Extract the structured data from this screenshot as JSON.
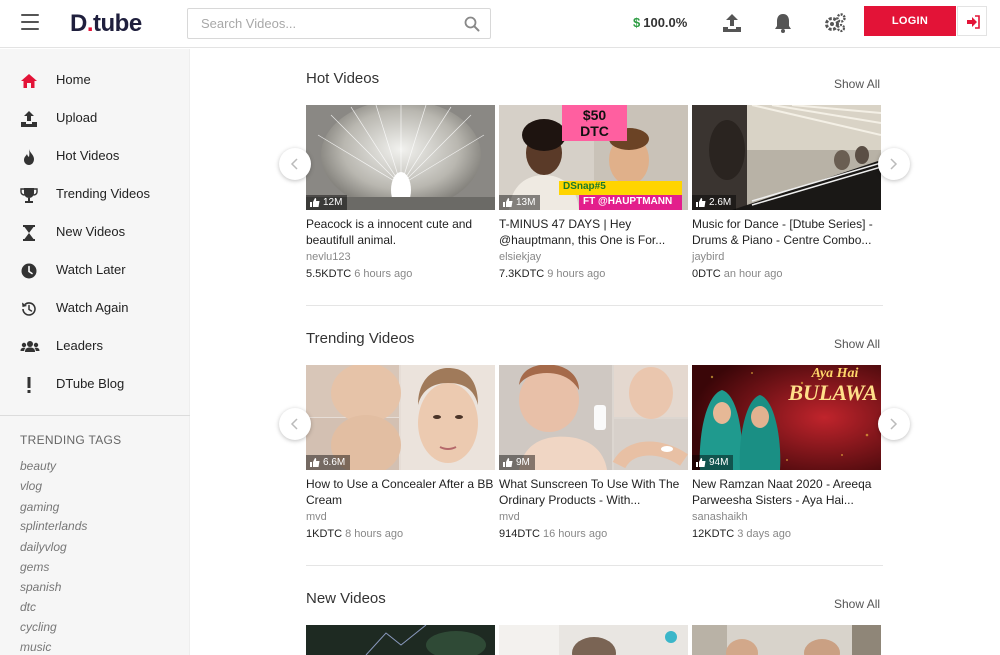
{
  "header": {
    "logo_main": "D",
    "logo_dot": ".",
    "logo_tail": "tube",
    "search_placeholder": "Search Videos...",
    "balance_currency": "$",
    "balance": "100.0%",
    "login_label": "LOGIN"
  },
  "colors": {
    "brand": "#e31337",
    "money": "#2e9d44"
  },
  "sidebar": {
    "items": [
      {
        "label": "Home",
        "icon": "home-icon"
      },
      {
        "label": "Upload",
        "icon": "upload-icon"
      },
      {
        "label": "Hot Videos",
        "icon": "flame-icon"
      },
      {
        "label": "Trending Videos",
        "icon": "trophy-icon"
      },
      {
        "label": "New Videos",
        "icon": "hourglass-icon"
      },
      {
        "label": "Watch Later",
        "icon": "clock-icon"
      },
      {
        "label": "Watch Again",
        "icon": "history-icon"
      },
      {
        "label": "Leaders",
        "icon": "users-icon"
      },
      {
        "label": "DTube Blog",
        "icon": "exclamation-icon"
      }
    ],
    "tags_title": "TRENDING TAGS",
    "tags": [
      "beauty",
      "vlog",
      "gaming",
      "splinterlands",
      "dailyvlog",
      "gems",
      "spanish",
      "dtc",
      "cycling",
      "music"
    ]
  },
  "sections": [
    {
      "title": "Hot Videos",
      "show_all": "Show All",
      "videos": [
        {
          "views": "12M",
          "title": "Peacock is a innocent cute and beautifull animal.",
          "author": "nevlu123",
          "value": "5.5KDTC",
          "ago": "6 hours ago"
        },
        {
          "views": "13M",
          "title": "T-MINUS 47 DAYS | Hey @hauptmann, this One is For...",
          "author": "elsiekjay",
          "value": "7.3KDTC",
          "ago": "9 hours ago",
          "thumb_text": [
            "$50",
            "DTC",
            "DSnap#5",
            "FT @HAUPTMANN"
          ]
        },
        {
          "views": "2.6M",
          "title": "Music for Dance - [Dtube Series] - Drums & Piano - Centre Combo...",
          "author": "jaybird",
          "value": "0DTC",
          "ago": "an hour ago"
        }
      ]
    },
    {
      "title": "Trending Videos",
      "show_all": "Show All",
      "videos": [
        {
          "views": "6.6M",
          "title": "How to Use a Concealer After a BB Cream",
          "author": "mvd",
          "value": "1KDTC",
          "ago": "8 hours ago"
        },
        {
          "views": "9M",
          "title": "What Sunscreen To Use With The Ordinary Products - With...",
          "author": "mvd",
          "value": "914DTC",
          "ago": "16 hours ago"
        },
        {
          "views": "94M",
          "title": "New Ramzan Naat 2020 - Areeqa Parweesha Sisters - Aya Hai...",
          "author": "sanashaikh",
          "value": "12KDTC",
          "ago": "3 days ago",
          "thumb_text": [
            "Aya Hai",
            "BULAWA"
          ]
        }
      ]
    },
    {
      "title": "New Videos",
      "show_all": "Show All",
      "videos": []
    }
  ]
}
